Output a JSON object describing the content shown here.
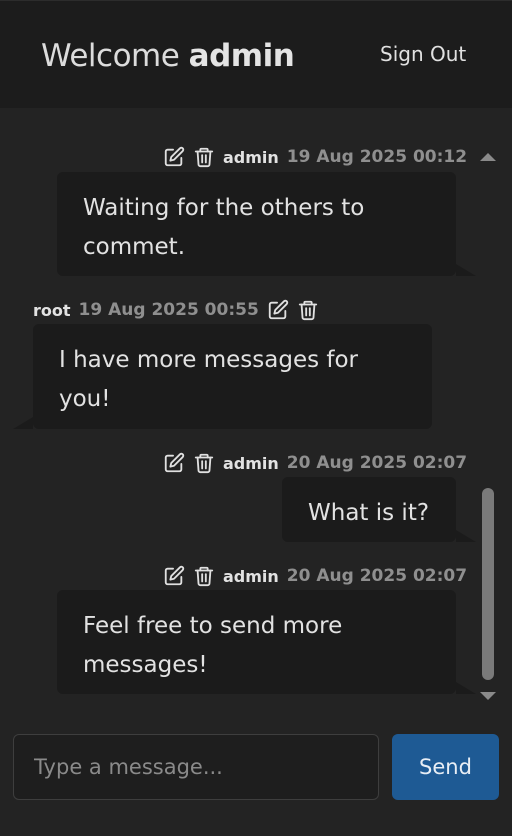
{
  "header": {
    "welcome_prefix": "Welcome",
    "username": "admin",
    "sign_out_label": "Sign Out"
  },
  "messages": [
    {
      "user": "admin",
      "time": "19 Aug 2025 00:12",
      "text": "Waiting for the others to commet.",
      "own": true
    },
    {
      "user": "root",
      "time": "19 Aug 2025 00:55",
      "text": "I have more messages for you!",
      "own": false
    },
    {
      "user": "admin",
      "time": "20 Aug 2025 02:07",
      "text": "What is it?",
      "own": true
    },
    {
      "user": "admin",
      "time": "20 Aug 2025 02:07",
      "text": "Feel free to send more messages!",
      "own": true
    }
  ],
  "composer": {
    "placeholder": "Type a message...",
    "value": "",
    "send_label": "Send"
  },
  "icons": {
    "edit": "edit-icon",
    "delete": "trash-icon"
  },
  "colors": {
    "background": "#232323",
    "header": "#1c1c1c",
    "bubble": "#1b1b1b",
    "timestamp": "#8f8f8f",
    "send_button": "#1e5a94"
  }
}
